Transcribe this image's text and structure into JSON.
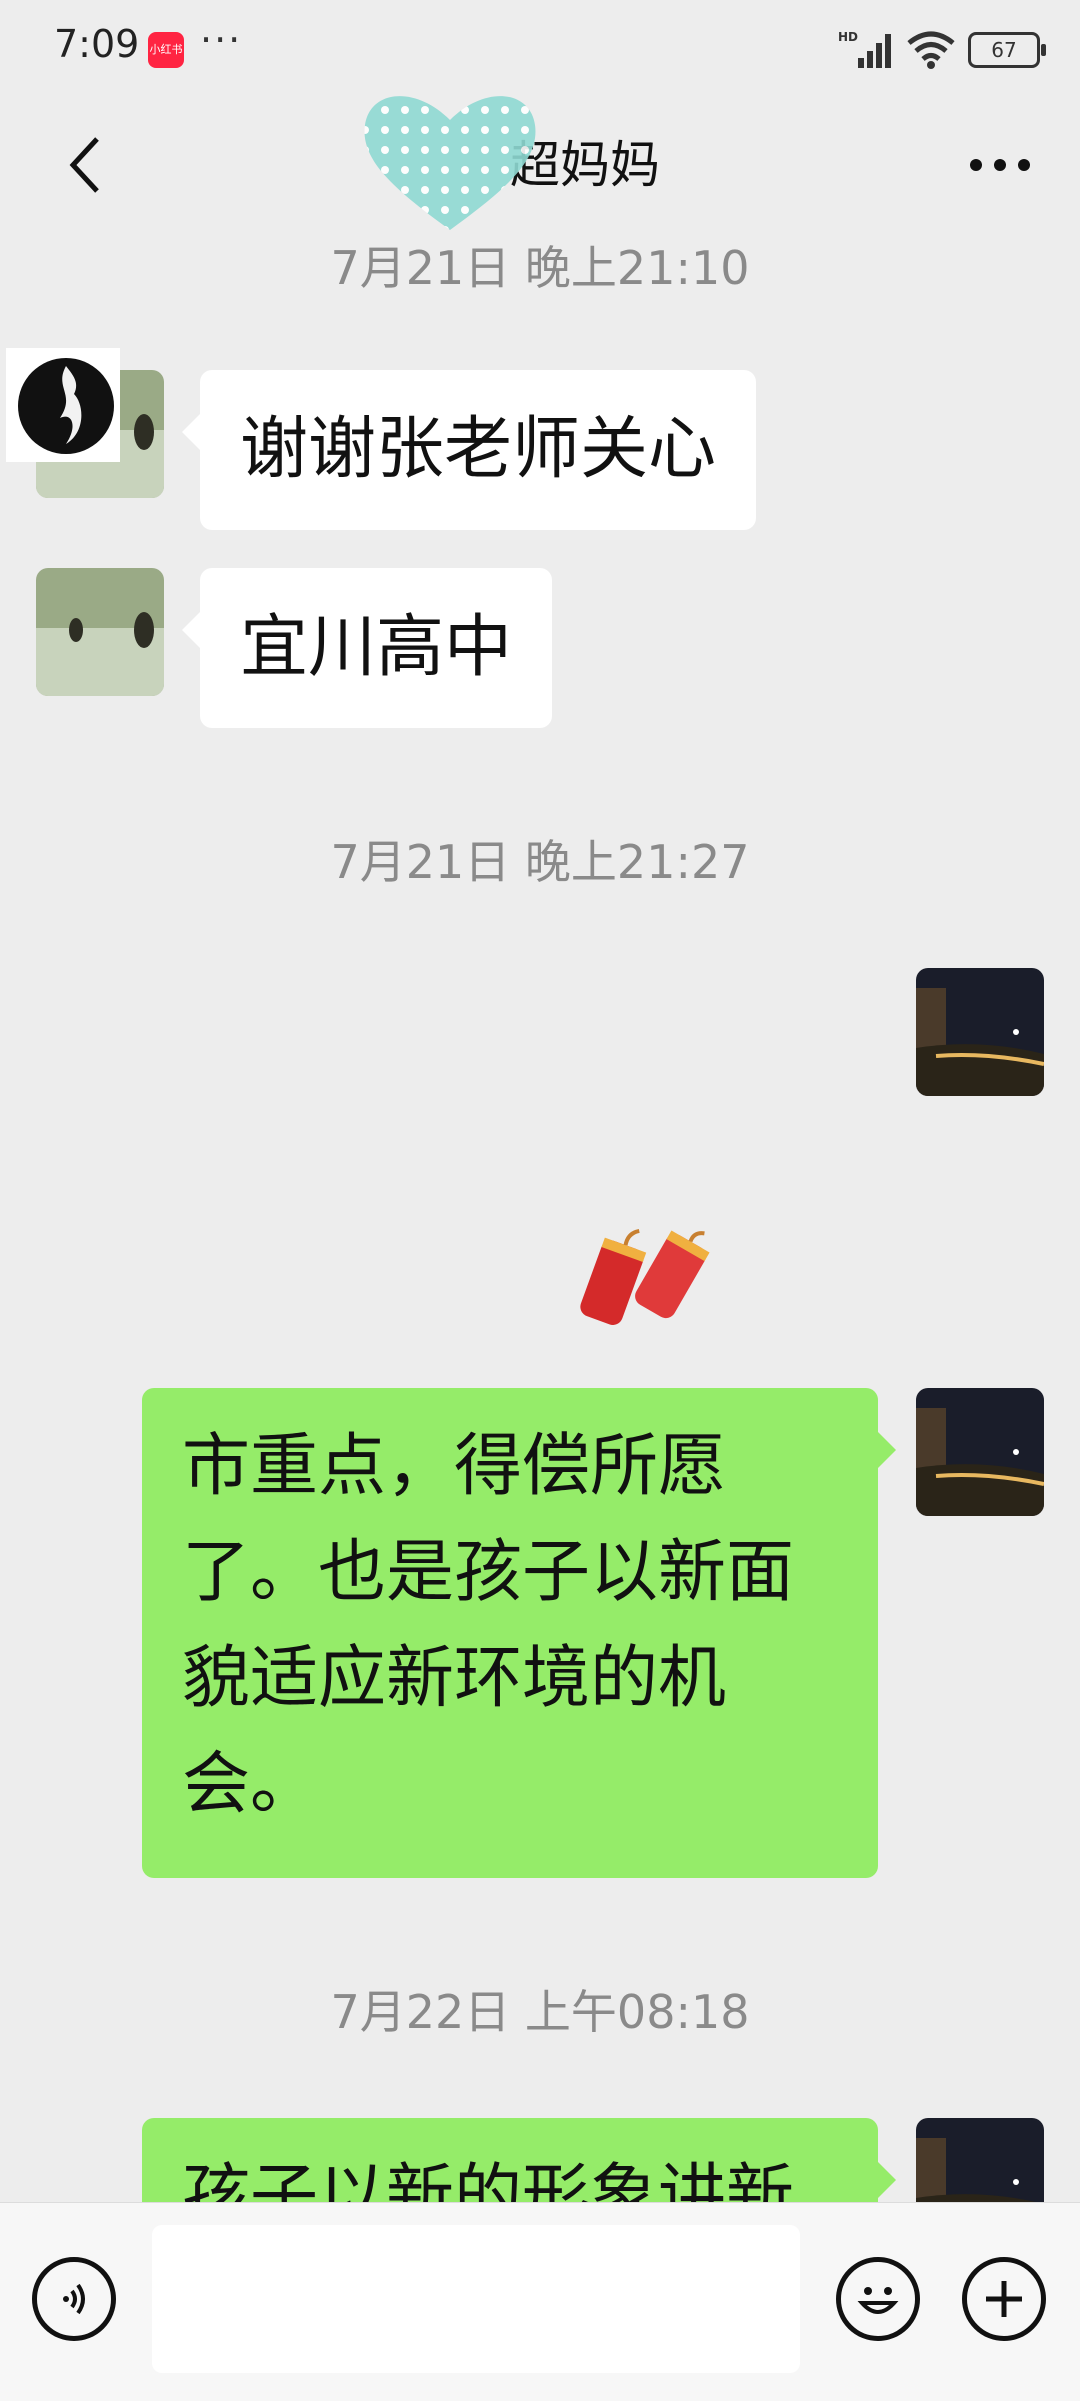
{
  "status": {
    "time": "7:09",
    "badge": "小红书",
    "dots": "···",
    "battery": "67",
    "network": "HD"
  },
  "header": {
    "title": "超妈妈"
  },
  "messages": {
    "ts1": "7月21日 晚上21:10",
    "msg1": "谢谢张老师关心",
    "msg2": "宜川高中",
    "ts2": "7月21日 晚上21:27",
    "msg3_line1": "市重点，得偿所愿",
    "msg3_line2": "了。也是孩子以新面",
    "msg3_line3": "貌适应新环境的机",
    "msg3_line4": "会。",
    "ts3": "7月22日 上午08:18",
    "msg4_partial": "孩子以新的形象讲新"
  },
  "input": {
    "placeholder": ""
  },
  "icons": {
    "back": "chevron-left-icon",
    "more": "more-icon",
    "voice": "voice-icon",
    "emoji": "emoji-icon",
    "plus": "plus-icon",
    "firecracker": "firecracker-sticker"
  },
  "colors": {
    "background": "#ededed",
    "outgoing_bubble": "#95ec69",
    "incoming_bubble": "#ffffff",
    "timestamp": "#8a8a8a"
  }
}
